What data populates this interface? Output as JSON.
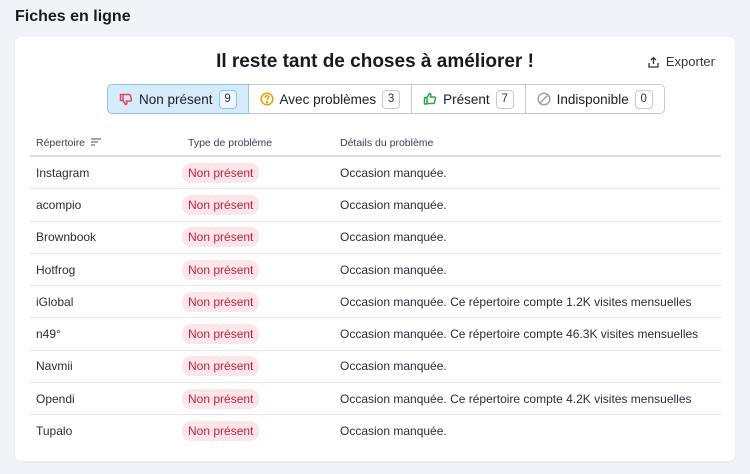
{
  "page": {
    "title": "Fiches en ligne"
  },
  "card": {
    "headline": "Il reste tant de choses à améliorer !",
    "export_label": "Exporter"
  },
  "filters": [
    {
      "label": "Non présent",
      "count": "9",
      "icon": "thumbs-down-icon",
      "active": true,
      "icon_color": "#e8445a"
    },
    {
      "label": "Avec problèmes",
      "count": "3",
      "icon": "question-circle-icon",
      "active": false,
      "icon_color": "#e4a100"
    },
    {
      "label": "Présent",
      "count": "7",
      "icon": "thumbs-up-icon",
      "active": false,
      "icon_color": "#2ca44b"
    },
    {
      "label": "Indisponible",
      "count": "0",
      "icon": "disabled-circle-icon",
      "active": false,
      "icon_color": "#9ea2ad"
    }
  ],
  "table": {
    "headers": [
      "Répertoire",
      "Type de problème",
      "Détails du problème"
    ],
    "rows": [
      {
        "directory": "Instagram",
        "type": "Non présent",
        "details": "Occasion manquée."
      },
      {
        "directory": "acompio",
        "type": "Non présent",
        "details": "Occasion manquée."
      },
      {
        "directory": "Brownbook",
        "type": "Non présent",
        "details": "Occasion manquée."
      },
      {
        "directory": "Hotfrog",
        "type": "Non présent",
        "details": "Occasion manquée."
      },
      {
        "directory": "iGlobal",
        "type": "Non présent",
        "details": "Occasion manquée. Ce répertoire compte 1.2K visites mensuelles"
      },
      {
        "directory": "n49°",
        "type": "Non présent",
        "details": "Occasion manquée. Ce répertoire compte 46.3K visites mensuelles"
      },
      {
        "directory": "Navmii",
        "type": "Non présent",
        "details": "Occasion manquée."
      },
      {
        "directory": "Opendi",
        "type": "Non présent",
        "details": "Occasion manquée. Ce répertoire compte 4.2K visites mensuelles"
      },
      {
        "directory": "Tupalo",
        "type": "Non présent",
        "details": "Occasion manquée."
      }
    ]
  },
  "colors": {
    "accent_active_bg": "#d6ebfb",
    "badge_bg": "#fde6e9",
    "badge_text": "#c21f3f"
  }
}
